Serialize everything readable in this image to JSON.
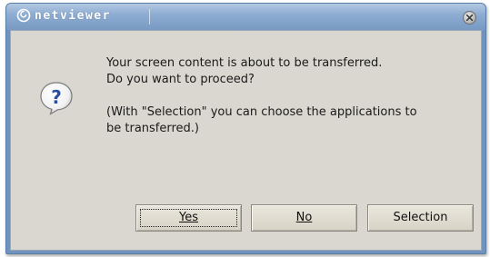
{
  "window": {
    "app_title": "netviewer",
    "close_icon": "close-icon"
  },
  "dialog": {
    "icon": "question-icon",
    "message_line1": "Your screen content is about to be transferred.",
    "message_line2": "Do you want to proceed?",
    "note_line1": "(With \"Selection\" you can choose the applications to",
    "note_line2": "be transferred.)"
  },
  "buttons": {
    "yes_label": "Yes",
    "no_label": "No",
    "selection_label": "Selection"
  },
  "colors": {
    "titlebar": "#7799c3",
    "client_bg": "#d9d7cf",
    "icon_blue": "#2b4fa0"
  }
}
